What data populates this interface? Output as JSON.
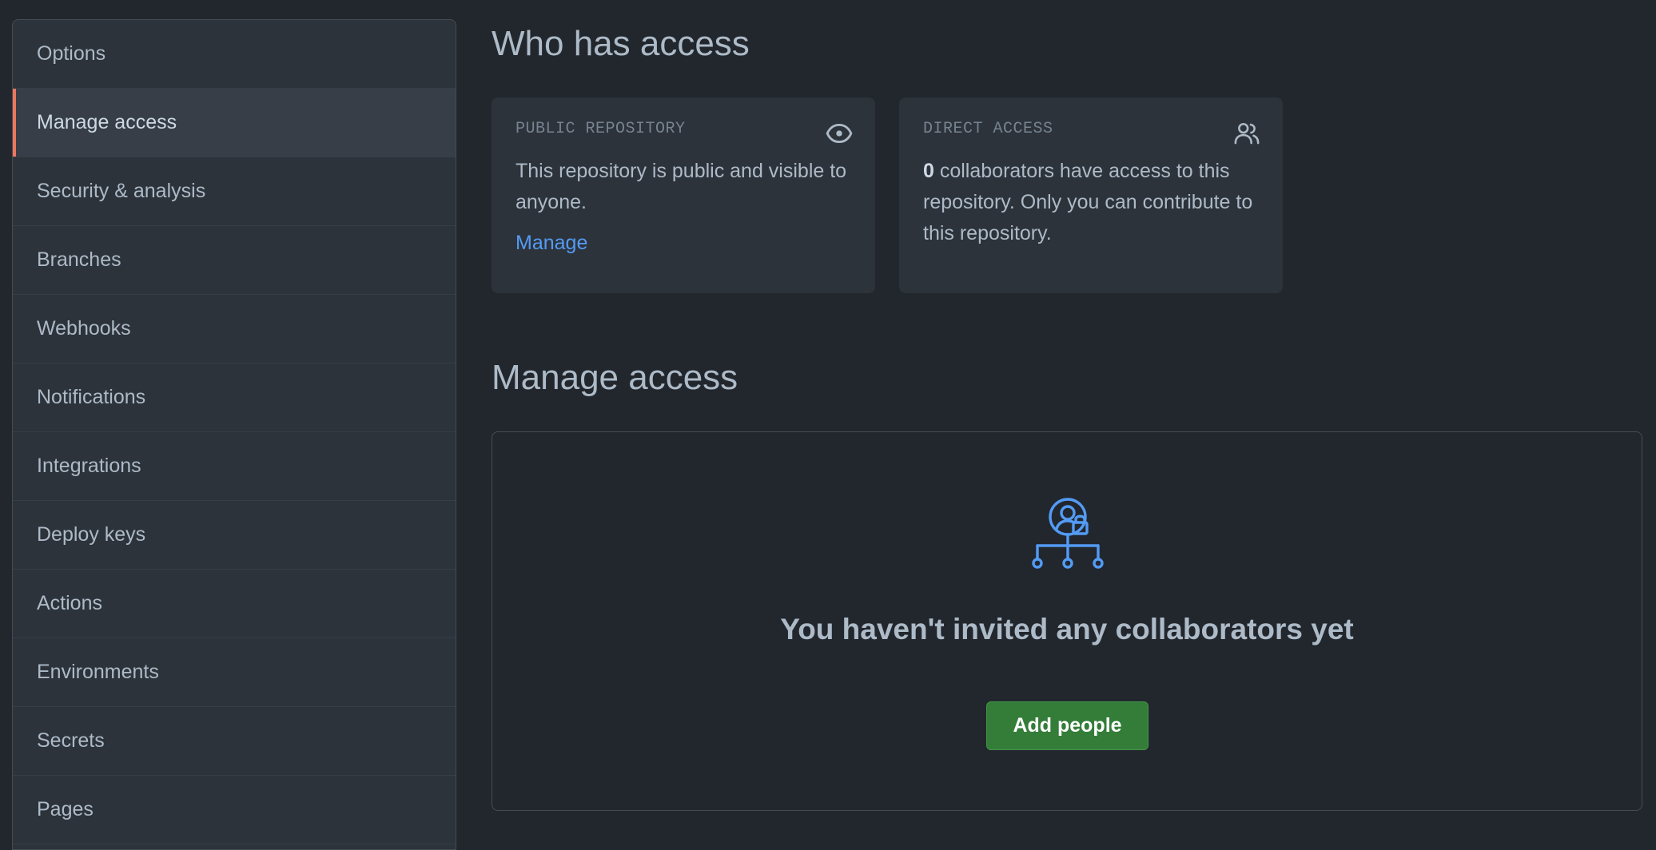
{
  "sidebar": {
    "items": [
      {
        "label": "Options"
      },
      {
        "label": "Manage access"
      },
      {
        "label": "Security & analysis"
      },
      {
        "label": "Branches"
      },
      {
        "label": "Webhooks"
      },
      {
        "label": "Notifications"
      },
      {
        "label": "Integrations"
      },
      {
        "label": "Deploy keys"
      },
      {
        "label": "Actions"
      },
      {
        "label": "Environments"
      },
      {
        "label": "Secrets"
      },
      {
        "label": "Pages"
      }
    ],
    "active_item": "Manage access"
  },
  "who_has_access": {
    "title": "Who has access",
    "public_card": {
      "label": "PUBLIC REPOSITORY",
      "icon": "eye-icon",
      "text": "This repository is public and visible to anyone.",
      "link": "Manage"
    },
    "direct_card": {
      "label": "DIRECT ACCESS",
      "icon": "people-icon",
      "count": "0",
      "text": " collaborators have access to this repository. Only you can contribute to this repository."
    }
  },
  "manage_access": {
    "title": "Manage access",
    "empty_icon": "person-lock-network-icon",
    "empty_title": "You haven't invited any collaborators yet",
    "add_button": "Add people"
  },
  "colors": {
    "background": "#22272e",
    "panel": "#2d333b",
    "active_indicator": "#ec775c",
    "link": "#539bf5",
    "button": "#347d39"
  }
}
